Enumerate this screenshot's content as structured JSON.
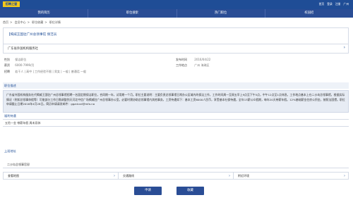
{
  "header": {
    "logo": "招聘之窗",
    "links": [
      "首页",
      "登录",
      "注册",
      "广州"
    ]
  },
  "nav": [
    "我的简历",
    "职位搜索",
    "热门职位",
    "校园招"
  ],
  "breadcrumb": [
    "首页",
    "会员中心",
    "职位收藏",
    "职位详情"
  ],
  "job": {
    "title": "【揭威王国驻广州总领事馆 保洁员",
    "company": "广东省外国机构服务社",
    "gender_label": "性别",
    "gender_value": "保洁职位",
    "salary_label": "薪资",
    "salary_value": "6000-7999/月",
    "recruit_label": "招聘",
    "recruit_value": "若干人 | 高中 | 工作经验不限 | 男女 | 一般 | 普通话 一般",
    "date_label": "发布时间",
    "date_value": "2016/04/22",
    "location_label": "工作地点",
    "location_value": "广州 海珠区"
  },
  "description": {
    "heading": "职位描述",
    "text": "广东省外国机构服务社代揭威王国驻广州总领事馆招聘一名固定期保洁职位，合同期一年，试用期一个月。职位主要说明：主要负责总领事馆日常办公区域内的保洁工作，工作时间周一至周五早上9点至下午5点，中午12点至1点休息。工作地点基本上在二沙岛总领事馆，根据实际情况（例如总领事休假等）可能部分工作日需调整到天河北中信广场揭威驻广州总领事办公室。必要时需协助总领事馆内其他事务，工资待遇如下：基本工资6000人民币，享受基本社保待遇，全年13薪公众假期，每年20天带薪年假。12%基础薪金住房公积金，按照法国惯。职位申请截止日期2016年4月28日。简历申请请发邮件：ggzdcvd@mfa.no"
  },
  "welfare": {
    "heading": "福利待遇",
    "text": "五险一金 带薪年假 周末双休"
  },
  "address": {
    "heading": "上班地址",
    "text": "二沙岛总领事官邸"
  },
  "actions": [
    "查看地图",
    "交通路线",
    "附近环境"
  ],
  "buttons": {
    "apply": "申请",
    "favorite": "收藏"
  },
  "colors": {
    "primary": "#2a4d95",
    "logo_bg": "#f2c81a",
    "desc_bg": "#e7ecf4"
  }
}
